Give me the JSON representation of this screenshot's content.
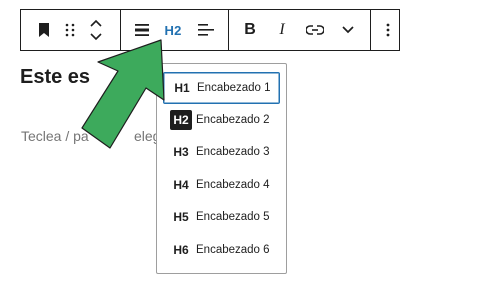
{
  "toolbar": {
    "heading_level_label": "H2",
    "bold_label": "B",
    "italic_label": "I"
  },
  "editor": {
    "heading_visible": "Este es",
    "paragraph_visible": "Teclea / pa",
    "paragraph_visible_tail": "elegir"
  },
  "dropdown": {
    "options": [
      {
        "level": "H1",
        "label": "Encabezado 1"
      },
      {
        "level": "H2",
        "label": "Encabezado 2"
      },
      {
        "level": "H3",
        "label": "Encabezado 3"
      },
      {
        "level": "H4",
        "label": "Encabezado 4"
      },
      {
        "level": "H5",
        "label": "Encabezado 5"
      },
      {
        "level": "H6",
        "label": "Encabezado 6"
      }
    ],
    "focused_level": "H1",
    "current_level": "H2"
  },
  "colors": {
    "accent": "#2271b1",
    "arrow": "#3daa5c"
  }
}
